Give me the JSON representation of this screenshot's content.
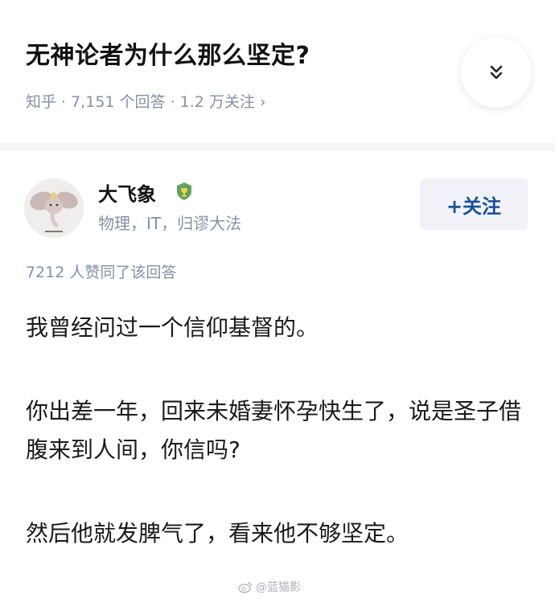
{
  "question": {
    "title": "无神论者为什么那么坚定?",
    "meta": "知乎 · 7,151 个回答 · 1.2 万关注",
    "meta_chevron": "›",
    "expand_icon": "chevron-double-down-icon"
  },
  "author": {
    "name": "大飞象",
    "bio": "物理，IT，归谬大法",
    "badge_icon": "trophy-badge-icon",
    "avatar_icon": "dumbo-elephant-avatar",
    "follow_label": "+关注"
  },
  "answer": {
    "vote_text": "7212 人赞同了该回答",
    "paragraphs": [
      "我曾经问过一个信仰基督的。",
      "你出差一年，回来未婚妻怀孕快生了，说是圣子借腹来到人间，你信吗?",
      "然后他就发脾气了，看来他不够坚定。"
    ]
  },
  "watermark": {
    "icon": "weibo-icon",
    "text": "@蓝猫影"
  },
  "colors": {
    "meta_gray": "#8590a6",
    "follow_blue": "#175199",
    "follow_bg": "#f0f2f7",
    "badge_green": "#5ea35e"
  }
}
